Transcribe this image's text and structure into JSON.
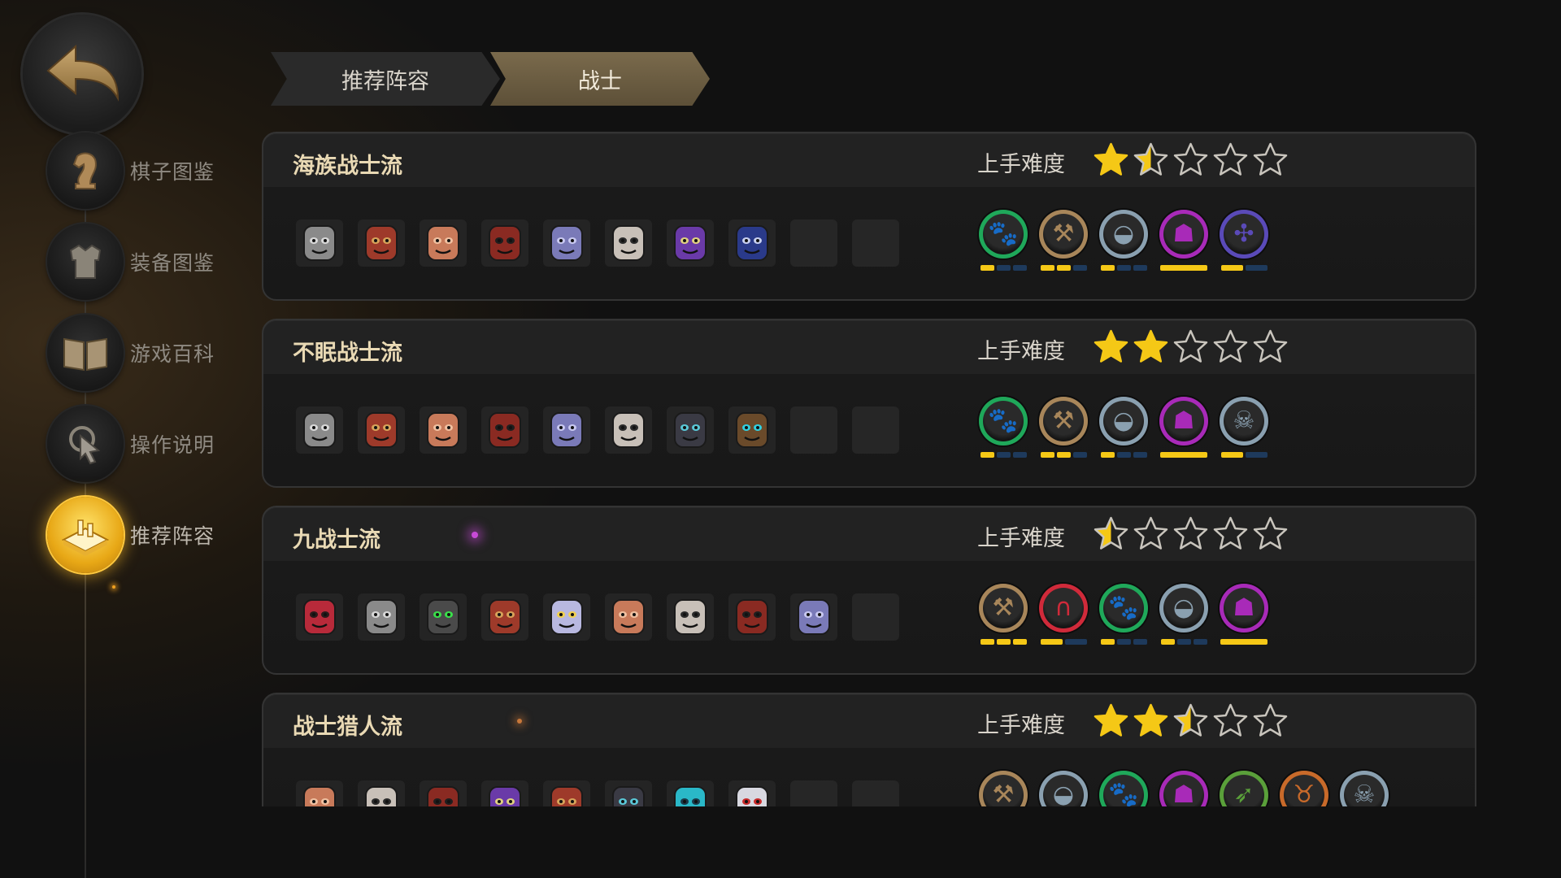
{
  "breadcrumb": [
    "推荐阵容",
    "战士"
  ],
  "nav": [
    {
      "label": "棋子图鉴",
      "icon": "knight-icon",
      "active": false
    },
    {
      "label": "装备图鉴",
      "icon": "armor-icon",
      "active": false
    },
    {
      "label": "游戏百科",
      "icon": "book-icon",
      "active": false
    },
    {
      "label": "操作说明",
      "icon": "cursor-icon",
      "active": false
    },
    {
      "label": "推荐阵容",
      "icon": "chessboard-icon",
      "active": true
    }
  ],
  "difficulty_label": "上手难度",
  "colors": {
    "accent": "#f5c816",
    "pip_off": "#1e3a5c",
    "title": "#e9d9b4"
  },
  "lineups": [
    {
      "name": "海族战士流",
      "difficulty": 1.5,
      "heroes": [
        {
          "icon": "knight-helmet-icon",
          "bg": "#8a8a8a",
          "fg": "#d8d8d8"
        },
        {
          "icon": "bearded-dwarf-icon",
          "bg": "#9e3a2a",
          "fg": "#d7a35a"
        },
        {
          "icon": "ogre-icon",
          "bg": "#c87a5a",
          "fg": "#f0c0a0"
        },
        {
          "icon": "pirate-captain-icon",
          "bg": "#8a2a22",
          "fg": "#1e1e1e"
        },
        {
          "icon": "purple-robot-icon",
          "bg": "#7a7ab8",
          "fg": "#c8c8f0"
        },
        {
          "icon": "skull-mask-icon",
          "bg": "#c8c0b8",
          "fg": "#2a2a2a"
        },
        {
          "icon": "purple-mage-icon",
          "bg": "#6a3aa8",
          "fg": "#e0d080"
        },
        {
          "icon": "blue-demon-icon",
          "bg": "#2a3a8a",
          "fg": "#c8d0f0"
        },
        {
          "icon": "empty-slot",
          "bg": "",
          "fg": ""
        },
        {
          "icon": "empty-slot",
          "bg": "",
          "fg": ""
        }
      ],
      "traits": [
        {
          "icon": "paw-icon",
          "color": "#1fa85a",
          "glyph": "🐾",
          "pips": [
            1,
            3
          ]
        },
        {
          "icon": "axe-icon",
          "color": "#a8865a",
          "glyph": "⚒",
          "pips": [
            2,
            3
          ]
        },
        {
          "icon": "pedestal-icon",
          "color": "#8aa0b0",
          "glyph": "◒",
          "pips": [
            1,
            3
          ]
        },
        {
          "icon": "demon-icon",
          "color": "#a82ab8",
          "glyph": "☗",
          "pips": [
            1,
            1
          ]
        },
        {
          "icon": "fishbone-icon",
          "color": "#5a4ab8",
          "glyph": "✣",
          "pips": [
            1,
            2
          ]
        }
      ]
    },
    {
      "name": "不眠战士流",
      "difficulty": 2,
      "heroes": [
        {
          "icon": "knight-helmet-icon",
          "bg": "#8a8a8a",
          "fg": "#d8d8d8"
        },
        {
          "icon": "bearded-dwarf-icon",
          "bg": "#9e3a2a",
          "fg": "#d7a35a"
        },
        {
          "icon": "ogre-icon",
          "bg": "#c87a5a",
          "fg": "#f0c0a0"
        },
        {
          "icon": "pirate-captain-icon",
          "bg": "#8a2a22",
          "fg": "#1e1e1e"
        },
        {
          "icon": "purple-robot-icon",
          "bg": "#7a7ab8",
          "fg": "#c8c8f0"
        },
        {
          "icon": "skull-mask-icon",
          "bg": "#c8c0b8",
          "fg": "#2a2a2a"
        },
        {
          "icon": "hooded-assassin-icon",
          "bg": "#3a3a44",
          "fg": "#5ac8d8"
        },
        {
          "icon": "golden-mask-icon",
          "bg": "#6a4a2a",
          "fg": "#30d0e0"
        },
        {
          "icon": "empty-slot",
          "bg": "",
          "fg": ""
        },
        {
          "icon": "empty-slot",
          "bg": "",
          "fg": ""
        }
      ],
      "traits": [
        {
          "icon": "paw-icon",
          "color": "#1fa85a",
          "glyph": "🐾",
          "pips": [
            1,
            3
          ]
        },
        {
          "icon": "axe-icon",
          "color": "#a8865a",
          "glyph": "⚒",
          "pips": [
            2,
            3
          ]
        },
        {
          "icon": "pedestal-icon",
          "color": "#8aa0b0",
          "glyph": "◒",
          "pips": [
            1,
            3
          ]
        },
        {
          "icon": "demon-icon",
          "color": "#a82ab8",
          "glyph": "☗",
          "pips": [
            1,
            1
          ]
        },
        {
          "icon": "skull-icon",
          "color": "#8aa0b0",
          "glyph": "☠",
          "pips": [
            1,
            2
          ]
        }
      ]
    },
    {
      "name": "九战士流",
      "difficulty": 0.5,
      "heroes": [
        {
          "icon": "red-demon-icon",
          "bg": "#b82a3a",
          "fg": "#2a1a1a"
        },
        {
          "icon": "knight-helmet-icon",
          "bg": "#8a8a8a",
          "fg": "#d8d8d8"
        },
        {
          "icon": "green-orb-icon",
          "bg": "#4a4a4a",
          "fg": "#3ae04a"
        },
        {
          "icon": "bearded-dwarf-icon",
          "bg": "#9e3a2a",
          "fg": "#d7a35a"
        },
        {
          "icon": "goggles-robot-icon",
          "bg": "#b8b8e0",
          "fg": "#f0d050"
        },
        {
          "icon": "ogre-icon",
          "bg": "#c87a5a",
          "fg": "#f0c0a0"
        },
        {
          "icon": "skull-mask-icon",
          "bg": "#c8c0b8",
          "fg": "#2a2a2a"
        },
        {
          "icon": "pirate-captain-icon",
          "bg": "#8a2a22",
          "fg": "#1e1e1e"
        },
        {
          "icon": "purple-robot-icon",
          "bg": "#7a7ab8",
          "fg": "#c8c8f0"
        },
        {
          "icon": "empty-slot",
          "bg": "",
          "fg": ""
        }
      ],
      "traits": [
        {
          "icon": "axe-icon",
          "color": "#a8865a",
          "glyph": "⚒",
          "pips": [
            3,
            3
          ]
        },
        {
          "icon": "arch-icon",
          "color": "#d02a3a",
          "glyph": "∩",
          "pips": [
            1,
            2
          ]
        },
        {
          "icon": "paw-icon",
          "color": "#1fa85a",
          "glyph": "🐾",
          "pips": [
            1,
            3
          ]
        },
        {
          "icon": "pedestal-icon",
          "color": "#8aa0b0",
          "glyph": "◒",
          "pips": [
            1,
            3
          ]
        },
        {
          "icon": "demon-icon",
          "color": "#a82ab8",
          "glyph": "☗",
          "pips": [
            1,
            1
          ]
        }
      ]
    },
    {
      "name": "战士猎人流",
      "difficulty": 2.5,
      "heroes": [
        {
          "icon": "ogre-icon",
          "bg": "#c87a5a",
          "fg": "#f0c0a0"
        },
        {
          "icon": "skull-mask-icon",
          "bg": "#c8c0b8",
          "fg": "#2a2a2a"
        },
        {
          "icon": "pirate-captain-icon",
          "bg": "#8a2a22",
          "fg": "#1e1e1e"
        },
        {
          "icon": "purple-mage-icon",
          "bg": "#6a3aa8",
          "fg": "#e0d080"
        },
        {
          "icon": "bearded-dwarf-icon",
          "bg": "#9e3a2a",
          "fg": "#d7a35a"
        },
        {
          "icon": "hooded-assassin-icon",
          "bg": "#3a3a44",
          "fg": "#5ac8d8"
        },
        {
          "icon": "cyan-robot-icon",
          "bg": "#2ab8c8",
          "fg": "#1a3a4a"
        },
        {
          "icon": "white-yeti-icon",
          "bg": "#d8d8e0",
          "fg": "#c82a2a"
        },
        {
          "icon": "empty-slot",
          "bg": "",
          "fg": ""
        },
        {
          "icon": "empty-slot",
          "bg": "",
          "fg": ""
        }
      ],
      "traits": [
        {
          "icon": "axe-icon",
          "color": "#a8865a",
          "glyph": "⚒",
          "pips": [
            0,
            0
          ]
        },
        {
          "icon": "pedestal-icon",
          "color": "#8aa0b0",
          "glyph": "◒",
          "pips": [
            0,
            0
          ]
        },
        {
          "icon": "paw-icon",
          "color": "#1fa85a",
          "glyph": "🐾",
          "pips": [
            0,
            0
          ]
        },
        {
          "icon": "demon-icon",
          "color": "#a82ab8",
          "glyph": "☗",
          "pips": [
            0,
            0
          ]
        },
        {
          "icon": "bow-icon",
          "color": "#5aa03a",
          "glyph": "➶",
          "pips": [
            0,
            0
          ]
        },
        {
          "icon": "horned-helmet-icon",
          "color": "#c86a2a",
          "glyph": "♉",
          "pips": [
            0,
            0
          ]
        },
        {
          "icon": "skull-icon",
          "color": "#8aa0b0",
          "glyph": "☠",
          "pips": [
            0,
            0
          ]
        }
      ]
    }
  ]
}
